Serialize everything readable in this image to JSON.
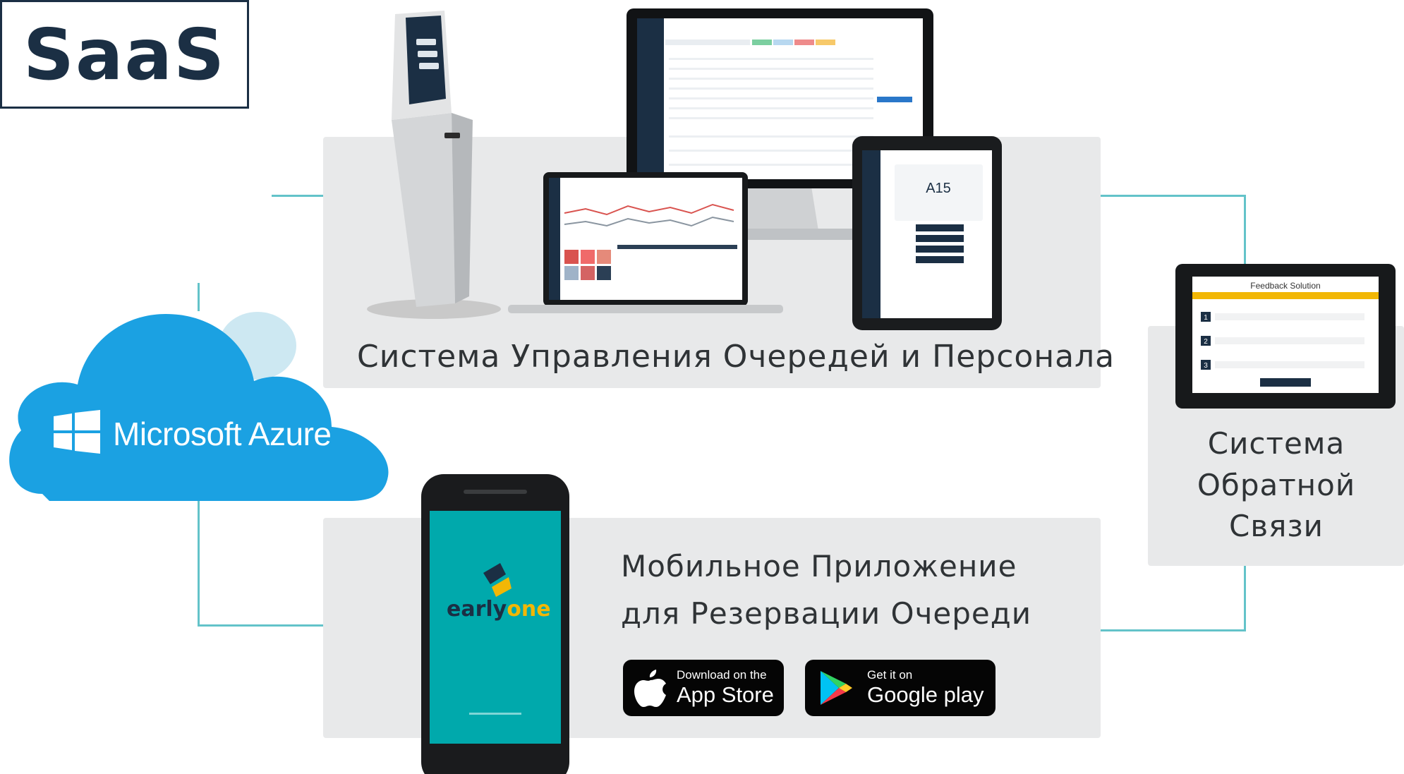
{
  "saas": {
    "label": "SaaS"
  },
  "cloud": {
    "label": "Microsoft Azure",
    "color": "#1ba1e2"
  },
  "queue_system": {
    "caption": "Система Управления Очередей и Персонала",
    "ticket": "A15"
  },
  "mobile_app": {
    "caption_line1": "Мобильное Приложение",
    "caption_line2": "для Резервации Очереди",
    "brand_early": "early",
    "brand_one": "one",
    "app_store": {
      "small": "Download on the",
      "big": "App Store"
    },
    "google_play": {
      "small": "Get it on",
      "big": "Google play"
    }
  },
  "feedback_system": {
    "caption_line1": "Система",
    "caption_line2": "Обратной",
    "caption_line3": "Связи",
    "screen_title": "Feedback Solution",
    "rows": [
      "1",
      "2",
      "3"
    ]
  },
  "colors": {
    "connector": "#63c3c9",
    "panel": "#e8e9ea",
    "navy": "#1b2f44",
    "teal": "#00a9ac",
    "accent": "#f2b705"
  }
}
